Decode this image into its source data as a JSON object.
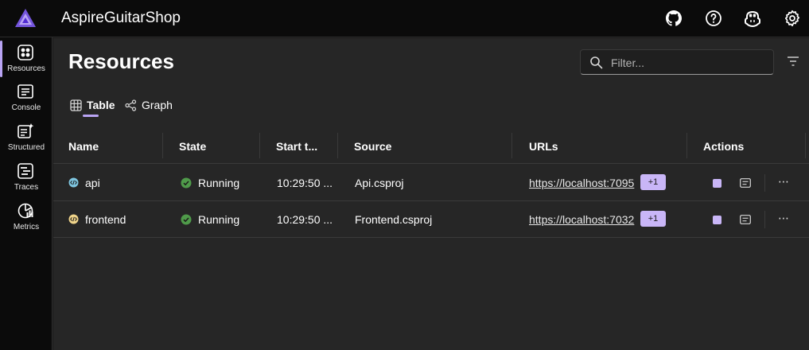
{
  "header": {
    "app_title": "AspireGuitarShop",
    "icons": [
      "github-icon",
      "help-icon",
      "copilot-icon",
      "settings-icon"
    ]
  },
  "sidebar": {
    "items": [
      {
        "label": "Resources",
        "icon": "resources-icon",
        "active": true
      },
      {
        "label": "Console",
        "icon": "console-icon",
        "active": false
      },
      {
        "label": "Structured",
        "icon": "structured-icon",
        "active": false
      },
      {
        "label": "Traces",
        "icon": "traces-icon",
        "active": false
      },
      {
        "label": "Metrics",
        "icon": "metrics-icon",
        "active": false
      }
    ]
  },
  "main": {
    "title": "Resources",
    "filter": {
      "placeholder": "Filter...",
      "value": ""
    },
    "tabs": [
      {
        "label": "Table",
        "icon": "table-icon",
        "selected": true
      },
      {
        "label": "Graph",
        "icon": "graph-icon",
        "selected": false
      }
    ]
  },
  "grid": {
    "columns": [
      "Name",
      "State",
      "Start t...",
      "Source",
      "URLs",
      "Actions"
    ],
    "rows": [
      {
        "name": "api",
        "state": "Running",
        "start_time": "10:29:50 ...",
        "source": "Api.csproj",
        "url": "https://localhost:7095",
        "url_badge": "+1",
        "more": "⋯",
        "name_icon_color": "#7fc6e0"
      },
      {
        "name": "frontend",
        "state": "Running",
        "start_time": "10:29:50 ...",
        "source": "Frontend.csproj",
        "url": "https://localhost:7032",
        "url_badge": "+1",
        "more": "⋯",
        "name_icon_color": "#f0d48a"
      }
    ]
  },
  "colors": {
    "accent": "#b9a4f4",
    "badge": "#c9b6f7",
    "running": "#4f9a4a",
    "background": "#262626",
    "chrome": "#0b0b0b"
  }
}
